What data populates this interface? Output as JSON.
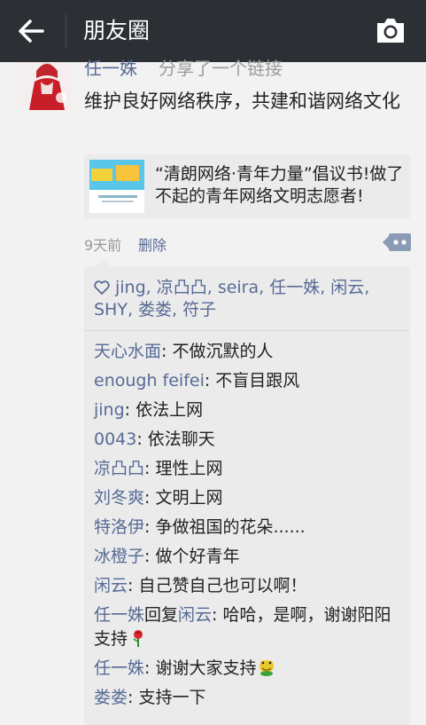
{
  "header": {
    "title": "朋友圈",
    "back_icon": "back-arrow-icon",
    "camera_icon": "camera-icon",
    "background": "#2c3035"
  },
  "post": {
    "author": "任一姝",
    "share_note": "分享了一个链接",
    "text": "维护良好网络秩序，共建和谐网络文化",
    "link": {
      "title": "“清朗网络·青年力量”倡议书!做了不起的青年网络文明志愿者!"
    },
    "time": "9天前",
    "delete_label": "删除",
    "more_icon": "more-dots-icon",
    "likes": "jing, 凉凸凸, seira, 任一姝, 闲云, SHY, 娄娄, 符子",
    "like_icon": "heart-icon",
    "comments": [
      {
        "name": "天心水面",
        "text": ": 不做沉默的人"
      },
      {
        "name": "enough feifei",
        "text": ": 不盲目跟风"
      },
      {
        "name": "jing",
        "text": ": 依法上网"
      },
      {
        "name": "0043",
        "text": ": 依法聊天"
      },
      {
        "name": "凉凸凸",
        "text": ": 理性上网"
      },
      {
        "name": "刘冬爽",
        "text": ": 文明上网"
      },
      {
        "name": "特洛伊",
        "text": ": 争做祖国的花朵......"
      },
      {
        "name": "冰橙子",
        "text": ": 做个好青年"
      },
      {
        "name": "闲云",
        "text": ": 自己赞自己也可以啊！"
      },
      {
        "name": "任一姝",
        "reply_word": "回复",
        "reply_to": "闲云",
        "text": ": 哈哈，是啊，谢谢阳阳支持",
        "emoji": "rose-emoji"
      },
      {
        "name": "任一姝",
        "text": ": 谢谢大家支持",
        "emoji": "frog-emoji"
      },
      {
        "name": "娄娄",
        "text": ": 支持一下"
      }
    ],
    "link_color": "#576b95"
  }
}
